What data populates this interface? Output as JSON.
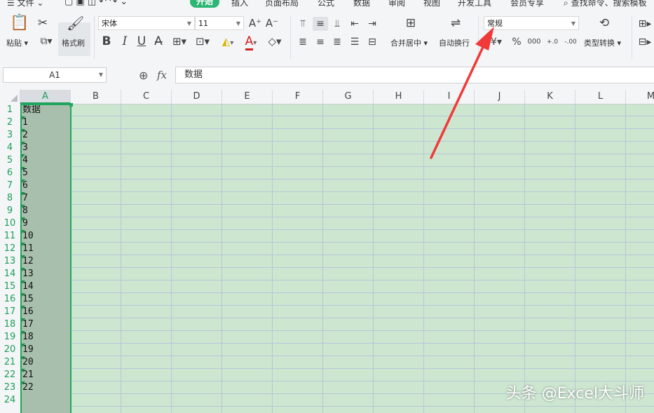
{
  "menu": {
    "file": "文件",
    "tabs": [
      "开始",
      "插入",
      "页面布局",
      "公式",
      "数据",
      "审阅",
      "视图",
      "开发工具",
      "会员专享"
    ],
    "active_tab": "开始",
    "search": "查找命令、搜索模板"
  },
  "ribbon": {
    "paste_label": "粘贴",
    "format_painter_label": "格式刷",
    "font_name": "宋体",
    "font_size": "11",
    "bold": "B",
    "italic": "I",
    "underline": "U",
    "font_color_glyph": "A",
    "merge_center_label": "合并居中",
    "wrap_text_label": "自动换行",
    "number_format": "常规",
    "percent": "%",
    "thousands": "000",
    "inc_decimal": "+.0",
    "dec_decimal": "-.00",
    "type_convert_label": "类型转换"
  },
  "formula_bar": {
    "name_box": "A1",
    "fx_label": "fx",
    "value": "数据"
  },
  "columns": [
    "A",
    "B",
    "C",
    "D",
    "E",
    "F",
    "G",
    "H",
    "I",
    "J",
    "K",
    "L",
    "M"
  ],
  "selected_column": "A",
  "rows": [
    "1",
    "2",
    "3",
    "4",
    "5",
    "6",
    "7",
    "8",
    "9",
    "10",
    "11",
    "12",
    "13",
    "14",
    "15",
    "16",
    "17",
    "18",
    "19",
    "20",
    "21",
    "22",
    "23",
    "24"
  ],
  "columnA": [
    "数据",
    "1",
    "2",
    "3",
    "4",
    "5",
    "6",
    "7",
    "8",
    "9",
    "10",
    "11",
    "12",
    "13",
    "14",
    "15",
    "16",
    "17",
    "18",
    "19",
    "20",
    "21",
    "22",
    ""
  ],
  "watermark": "头条 @Excel大斗师",
  "colors": {
    "accent": "#2bb673",
    "selection_border": "#1ea85f",
    "cell_bg": "#cde6d0",
    "selected_col_bg": "#a9bfad",
    "arrow": "#f03a3a"
  }
}
